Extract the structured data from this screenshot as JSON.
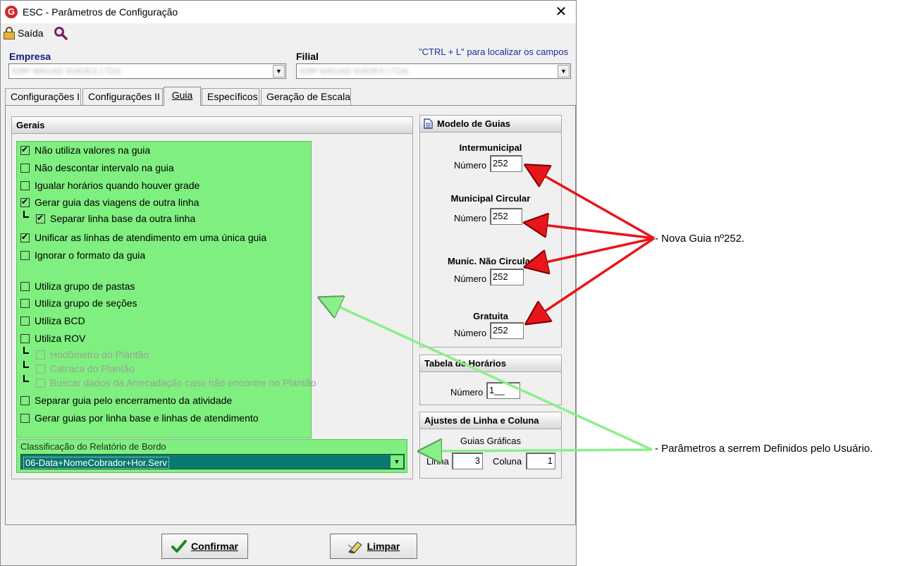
{
  "window": {
    "title": "ESC - Parâmetros de Configuração",
    "logo_letter": "G"
  },
  "toolbar": {
    "exit_label": "Saída"
  },
  "company": {
    "empresa_label": "Empresa",
    "filial_label": "Filial",
    "empresa_value": "EMP MAGAD IDADES LTDA",
    "filial_value": "EMP MAGAD IDADES LTDA",
    "hint": "\"CTRL + L\" para localizar os campos"
  },
  "tabs": [
    {
      "label": "Configurações I"
    },
    {
      "label": "Configurações II"
    },
    {
      "label": "Guia"
    },
    {
      "label": "Específicos"
    },
    {
      "label": "Geração de Escala"
    }
  ],
  "active_tab": "Guia",
  "gerais": {
    "title": "Gerais",
    "options": [
      {
        "label": "Não utiliza valores na guia",
        "checked": true
      },
      {
        "label": "Não descontar intervalo na guia",
        "checked": false
      },
      {
        "label": "Igualar horários quando houver grade",
        "checked": false
      },
      {
        "label": "Gerar guia das viagens de outra linha",
        "checked": true
      },
      {
        "label": "Separar linha base da outra linha",
        "checked": true
      },
      {
        "label": "Unificar as linhas de atendimento em uma única guia",
        "checked": true
      },
      {
        "label": "Ignorar o formato da guia",
        "checked": false
      },
      {
        "label": "Utiliza grupo de pastas",
        "checked": false
      },
      {
        "label": "Utiliza grupo de seções",
        "checked": false
      },
      {
        "label": "Utiliza BCD",
        "checked": false
      },
      {
        "label": "Utiliza ROV",
        "checked": false
      },
      {
        "label": "Hodômetro do Plantão",
        "checked": false
      },
      {
        "label": "Catraca do Plantão",
        "checked": false
      },
      {
        "label": "Buscar dados da Arrecadação caso não encontre no Plantão",
        "checked": false
      },
      {
        "label": "Separar guia pelo encerramento da atividade",
        "checked": false
      },
      {
        "label": "Gerar guias por linha base e linhas de atendimento",
        "checked": false
      }
    ],
    "classificacao_label": "Classificação do Relatório de Bordo",
    "classificacao_value": "06-Data+NomeCobrador+Hor.Serv"
  },
  "modelo_guias": {
    "title": "Modelo de Guias",
    "numero_label": "Número",
    "items": [
      {
        "title": "Intermunicipal",
        "value": "252"
      },
      {
        "title": "Municipal Circular",
        "value": "252"
      },
      {
        "title": "Munic. Não Circular",
        "value": "252"
      },
      {
        "title": "Gratuita",
        "value": "252"
      }
    ]
  },
  "tabela_horarios": {
    "title": "Tabela de Horários",
    "numero_label": "Número",
    "value": "1__"
  },
  "ajustes": {
    "title": "Ajustes de Linha e Coluna",
    "subtitle": "Guias Gráficas",
    "linha_label": "Linha",
    "linha_value": "3",
    "coluna_label": "Coluna",
    "coluna_value": "1"
  },
  "buttons": {
    "confirmar": "Confirmar",
    "limpar": "Limpar"
  },
  "annotations": {
    "nova_guia": "- Nova Guia nº252.",
    "parametros": "- Parâmetros a serrem Definidos pelo Usuário."
  },
  "colors": {
    "highlight_green": "#7fef7f",
    "arrow_red": "#e8151b",
    "arrow_green": "#8af08a"
  }
}
